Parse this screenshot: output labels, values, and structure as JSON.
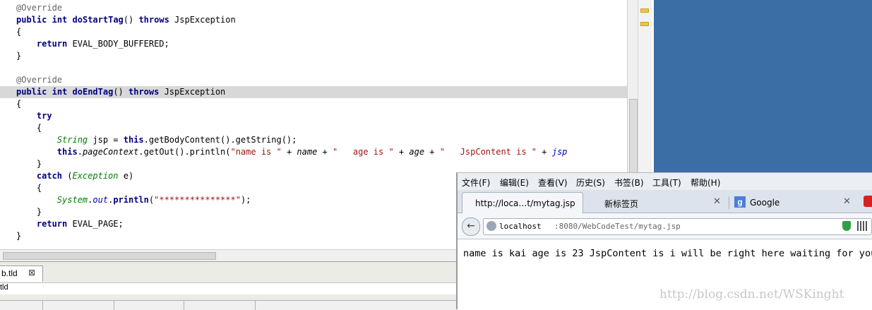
{
  "editor": {
    "lines": [
      [
        {
          "t": "@Override",
          "c": "ann"
        }
      ],
      [
        {
          "t": "public",
          "c": "kw"
        },
        {
          "t": " ",
          "c": "plain"
        },
        {
          "t": "int",
          "c": "kw"
        },
        {
          "t": " ",
          "c": "plain"
        },
        {
          "t": "doStartTag",
          "c": "kw"
        },
        {
          "t": "() ",
          "c": "plain"
        },
        {
          "t": "throws",
          "c": "kw"
        },
        {
          "t": " JspException",
          "c": "plain"
        }
      ],
      [
        {
          "t": "{",
          "c": "plain"
        }
      ],
      [
        {
          "t": "    ",
          "c": "plain"
        },
        {
          "t": "return",
          "c": "kw"
        },
        {
          "t": " EVAL_BODY_BUFFERED;",
          "c": "plain"
        }
      ],
      [
        {
          "t": "}",
          "c": "plain"
        }
      ],
      [],
      [
        {
          "t": "@Override",
          "c": "ann"
        }
      ],
      [
        {
          "t": "public",
          "c": "kw"
        },
        {
          "t": " ",
          "c": "plain"
        },
        {
          "t": "int",
          "c": "kw"
        },
        {
          "t": " ",
          "c": "plain"
        },
        {
          "t": "doEndTag",
          "c": "kw"
        },
        {
          "t": "() ",
          "c": "plain"
        },
        {
          "t": "throws",
          "c": "kw"
        },
        {
          "t": " JspException",
          "c": "plain"
        }
      ],
      [
        {
          "t": "{",
          "c": "plain"
        }
      ],
      [
        {
          "t": "    ",
          "c": "plain"
        },
        {
          "t": "try",
          "c": "kw"
        }
      ],
      [
        {
          "t": "    {",
          "c": "plain"
        }
      ],
      [
        {
          "t": "        ",
          "c": "plain"
        },
        {
          "t": "String",
          "c": "type"
        },
        {
          "t": " jsp = ",
          "c": "plain"
        },
        {
          "t": "this",
          "c": "kw"
        },
        {
          "t": ".getBodyContent().getString();",
          "c": "plain"
        }
      ],
      [
        {
          "t": "        ",
          "c": "plain"
        },
        {
          "t": "this",
          "c": "kw"
        },
        {
          "t": ".",
          "c": "plain"
        },
        {
          "t": "pageContext",
          "c": "it"
        },
        {
          "t": ".getOut().println(",
          "c": "plain"
        },
        {
          "t": "\"name is \"",
          "c": "str"
        },
        {
          "t": " + ",
          "c": "plain"
        },
        {
          "t": "name",
          "c": "it"
        },
        {
          "t": " + ",
          "c": "plain"
        },
        {
          "t": "\"   age is \"",
          "c": "str"
        },
        {
          "t": " + ",
          "c": "plain"
        },
        {
          "t": "age",
          "c": "it"
        },
        {
          "t": " + ",
          "c": "plain"
        },
        {
          "t": "\"   JspContent is \"",
          "c": "str"
        },
        {
          "t": " + ",
          "c": "plain"
        },
        {
          "t": "jsp",
          "c": "field"
        }
      ],
      [
        {
          "t": "    }",
          "c": "plain"
        }
      ],
      [
        {
          "t": "    ",
          "c": "plain"
        },
        {
          "t": "catch",
          "c": "kw"
        },
        {
          "t": " (",
          "c": "plain"
        },
        {
          "t": "Exception",
          "c": "type"
        },
        {
          "t": " e)",
          "c": "plain"
        }
      ],
      [
        {
          "t": "    {",
          "c": "plain"
        }
      ],
      [
        {
          "t": "        ",
          "c": "plain"
        },
        {
          "t": "System",
          "c": "type"
        },
        {
          "t": ".",
          "c": "plain"
        },
        {
          "t": "out",
          "c": "field"
        },
        {
          "t": ".",
          "c": "plain"
        },
        {
          "t": "println",
          "c": "kw"
        },
        {
          "t": "(",
          "c": "plain"
        },
        {
          "t": "\"***************\"",
          "c": "str"
        },
        {
          "t": ");",
          "c": "plain"
        }
      ],
      [
        {
          "t": "    }",
          "c": "plain"
        }
      ],
      [
        {
          "t": "    ",
          "c": "plain"
        },
        {
          "t": "return",
          "c": "kw"
        },
        {
          "t": " EVAL_PAGE;",
          "c": "plain"
        }
      ],
      [
        {
          "t": "}",
          "c": "plain"
        }
      ]
    ],
    "highlighted_line": 7
  },
  "bottom_view": {
    "tab_label": "b.tld",
    "tab_close": "⊠",
    "sub_label": "tld"
  },
  "browser": {
    "menu": [
      "文件(F)",
      "编辑(E)",
      "查看(V)",
      "历史(S)",
      "书签(B)",
      "工具(T)",
      "帮助(H)"
    ],
    "tabs": [
      {
        "label": "http://loca…t/mytag.jsp",
        "active": true
      },
      {
        "label": "新标签页",
        "active": false
      },
      {
        "label": "Google",
        "active": false
      }
    ],
    "tab_close": "✕",
    "google_icon": "g",
    "back_icon": "←",
    "url_host": "localhost",
    "url_rest": ":8080/WebCodeTest/mytag.jsp",
    "page_text": "name is kai age is 23 JspContent is i will be right here waiting for you",
    "watermark": "http://blog.csdn.net/WSKinght"
  }
}
